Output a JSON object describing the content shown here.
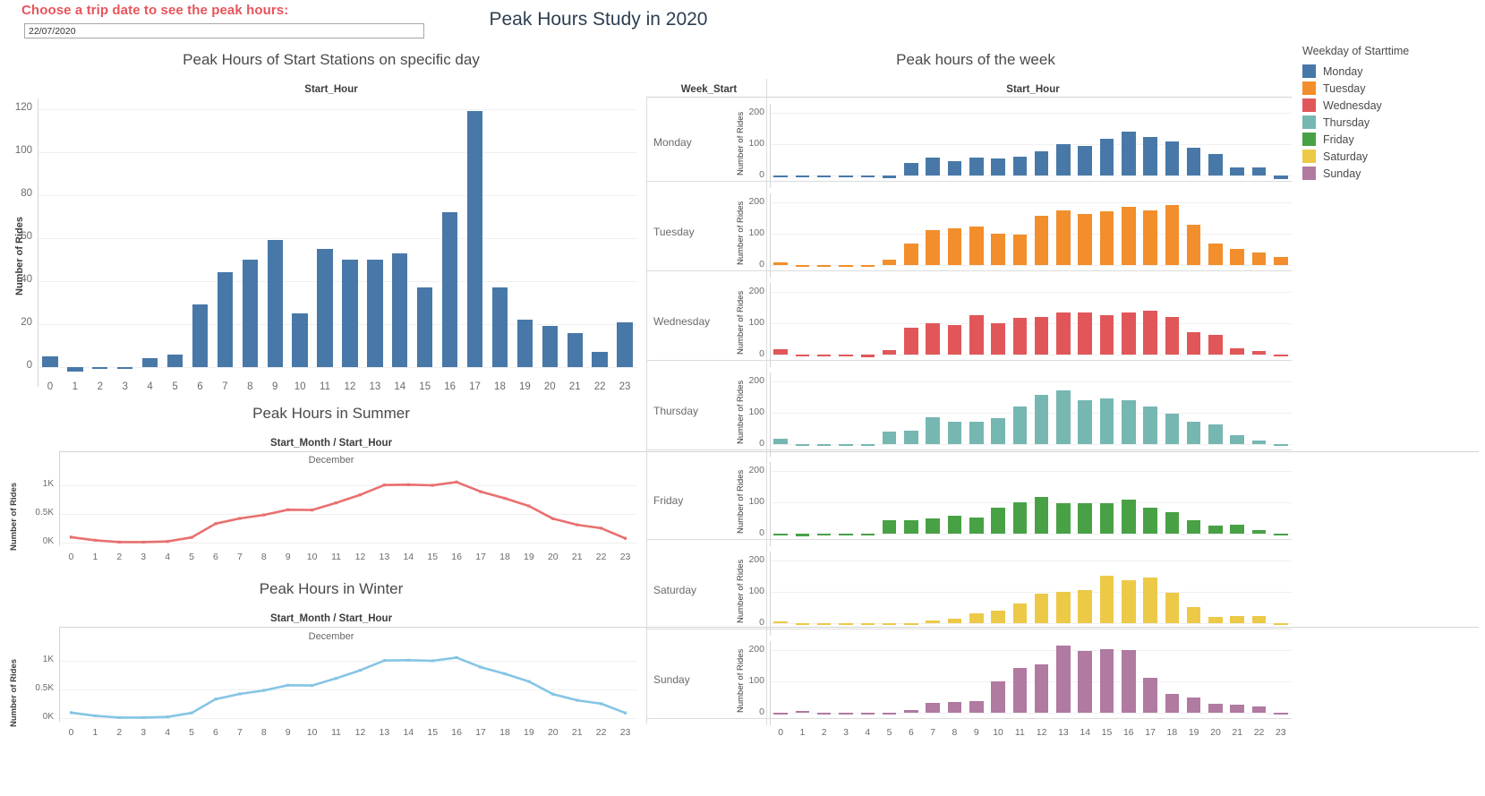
{
  "header": {
    "filter_label": "Choose a trip date to see the peak hours:",
    "date_value": "22/07/2020",
    "dashboard_title": "Peak Hours Study in 2020"
  },
  "legend": {
    "title": "Weekday of Starttime",
    "items": [
      {
        "label": "Monday",
        "color": "#4878a8"
      },
      {
        "label": "Tuesday",
        "color": "#f28e2b"
      },
      {
        "label": "Wednesday",
        "color": "#e15759"
      },
      {
        "label": "Thursday",
        "color": "#76b7b2"
      },
      {
        "label": "Friday",
        "color": "#49a146"
      },
      {
        "label": "Saturday",
        "color": "#edc948"
      },
      {
        "label": "Sunday",
        "color": "#b07aa1"
      }
    ]
  },
  "panels": {
    "day_bar_title": "Peak Hours of Start Stations on specific day",
    "summer_title": "Peak Hours in Summer",
    "winter_title": "Peak Hours in Winter",
    "week_title": "Peak hours of the week",
    "field_start_hour": "Start_Hour",
    "field_week_start": "Week_Start",
    "field_month_hour": "Start_Month / Start_Hour",
    "sub_december": "December",
    "axis_rides": "Number of Rides"
  },
  "chart_data": [
    {
      "type": "bar",
      "title": "Peak Hours of Start Stations on specific day",
      "xlabel": "Start_Hour",
      "ylabel": "Number of Rides",
      "ylim": [
        -5,
        125
      ],
      "yticks": [
        0,
        20,
        40,
        60,
        80,
        100,
        120
      ],
      "ytick_labels": [
        "0",
        "20",
        "40",
        "60",
        "80",
        "100",
        "120"
      ],
      "color": "#4878a8",
      "grid": true,
      "categories": [
        "0",
        "1",
        "2",
        "3",
        "4",
        "5",
        "6",
        "7",
        "8",
        "9",
        "10",
        "11",
        "12",
        "13",
        "14",
        "15",
        "16",
        "17",
        "18",
        "19",
        "20",
        "21",
        "22",
        "23"
      ],
      "values": [
        5,
        -2,
        -1,
        -1,
        4,
        6,
        29,
        44,
        50,
        59,
        25,
        55,
        50,
        50,
        53,
        37,
        72,
        119,
        37,
        22,
        19,
        16,
        7,
        21
      ]
    },
    {
      "type": "line",
      "title": "Peak Hours in Summer",
      "xlabel": "Start_Month / Start_Hour",
      "sublabel": "December",
      "ylabel": "Number of Rides",
      "ylim": [
        0,
        1150
      ],
      "yticks": [
        0,
        500,
        1000
      ],
      "ytick_labels": [
        "0K",
        "0.5K",
        "1K"
      ],
      "color": "#e8706f",
      "grid": true,
      "markers": true,
      "x": [
        "0",
        "1",
        "2",
        "3",
        "4",
        "5",
        "6",
        "7",
        "8",
        "9",
        "10",
        "11",
        "12",
        "13",
        "14",
        "15",
        "16",
        "17",
        "18",
        "19",
        "20",
        "21",
        "22",
        "23"
      ],
      "values": [
        95,
        40,
        10,
        10,
        20,
        90,
        330,
        420,
        480,
        570,
        565,
        690,
        830,
        1000,
        1005,
        995,
        1050,
        885,
        770,
        635,
        415,
        310,
        250,
        75
      ]
    },
    {
      "type": "line",
      "title": "Peak Hours in Winter",
      "xlabel": "Start_Month / Start_Hour",
      "sublabel": "December",
      "ylabel": "Number of Rides",
      "ylim": [
        0,
        1150
      ],
      "yticks": [
        0,
        500,
        1000
      ],
      "ytick_labels": [
        "0K",
        "0.5K",
        "1K"
      ],
      "color": "#85c5e5",
      "grid": true,
      "markers": true,
      "x": [
        "0",
        "1",
        "2",
        "3",
        "4",
        "5",
        "6",
        "7",
        "8",
        "9",
        "10",
        "11",
        "12",
        "13",
        "14",
        "15",
        "16",
        "17",
        "18",
        "19",
        "20",
        "21",
        "22",
        "23"
      ],
      "values": [
        95,
        40,
        10,
        10,
        20,
        90,
        330,
        420,
        480,
        570,
        565,
        690,
        830,
        1000,
        1005,
        995,
        1050,
        885,
        770,
        635,
        415,
        310,
        250,
        90
      ]
    },
    {
      "type": "bar",
      "title": "Peak hours of the week",
      "layout": "small-multiples-rows",
      "row_field": "Week_Start",
      "xlabel": "Start_Hour",
      "ylabel": "Number of Rides",
      "ylim": [
        -15,
        230
      ],
      "yticks": [
        0,
        100,
        200
      ],
      "ytick_labels": [
        "0",
        "100",
        "200"
      ],
      "grid": true,
      "categories": [
        "0",
        "1",
        "2",
        "3",
        "4",
        "5",
        "6",
        "7",
        "8",
        "9",
        "10",
        "11",
        "12",
        "13",
        "14",
        "15",
        "16",
        "17",
        "18",
        "19",
        "20",
        "21",
        "22",
        "23"
      ],
      "series": [
        {
          "name": "Monday",
          "color": "#4878a8",
          "values": [
            -7,
            0,
            0,
            -4,
            -6,
            -8,
            40,
            57,
            47,
            57,
            54,
            59,
            79,
            101,
            94,
            119,
            142,
            125,
            110,
            88,
            69,
            27,
            27,
            -12
          ]
        },
        {
          "name": "Tuesday",
          "color": "#f28e2b",
          "values": [
            10,
            0,
            0,
            -3,
            -7,
            18,
            70,
            112,
            117,
            125,
            101,
            97,
            157,
            175,
            163,
            172,
            187,
            176,
            192,
            128,
            68,
            52,
            41,
            25
          ]
        },
        {
          "name": "Wednesday",
          "color": "#e15759",
          "values": [
            16,
            -4,
            0,
            -4,
            -8,
            14,
            85,
            101,
            95,
            126,
            101,
            117,
            121,
            135,
            134,
            127,
            135,
            140,
            121,
            72,
            62,
            21,
            12,
            0
          ]
        },
        {
          "name": "Thursday",
          "color": "#76b7b2",
          "values": [
            16,
            -3,
            0,
            -4,
            -6,
            39,
            44,
            85,
            73,
            71,
            84,
            121,
            158,
            173,
            140,
            148,
            141,
            122,
            97,
            71,
            64,
            30,
            12,
            0
          ]
        },
        {
          "name": "Friday",
          "color": "#49a146",
          "values": [
            -7,
            -9,
            0,
            -4,
            -6,
            43,
            43,
            48,
            58,
            53,
            84,
            102,
            118,
            98,
            98,
            98,
            108,
            82,
            69,
            43,
            26,
            29,
            11,
            0
          ]
        },
        {
          "name": "Saturday",
          "color": "#edc948",
          "values": [
            6,
            -4,
            -7,
            -6,
            0,
            -6,
            -4,
            9,
            14,
            31,
            41,
            64,
            94,
            101,
            107,
            152,
            139,
            147,
            99,
            52,
            20,
            22,
            24,
            -4
          ]
        },
        {
          "name": "Sunday",
          "color": "#b07aa1",
          "values": [
            -4,
            6,
            -3,
            -3,
            -4,
            -4,
            8,
            32,
            35,
            37,
            102,
            143,
            154,
            216,
            198,
            203,
            201,
            113,
            60,
            50,
            28,
            26,
            19,
            -6
          ]
        }
      ]
    }
  ]
}
